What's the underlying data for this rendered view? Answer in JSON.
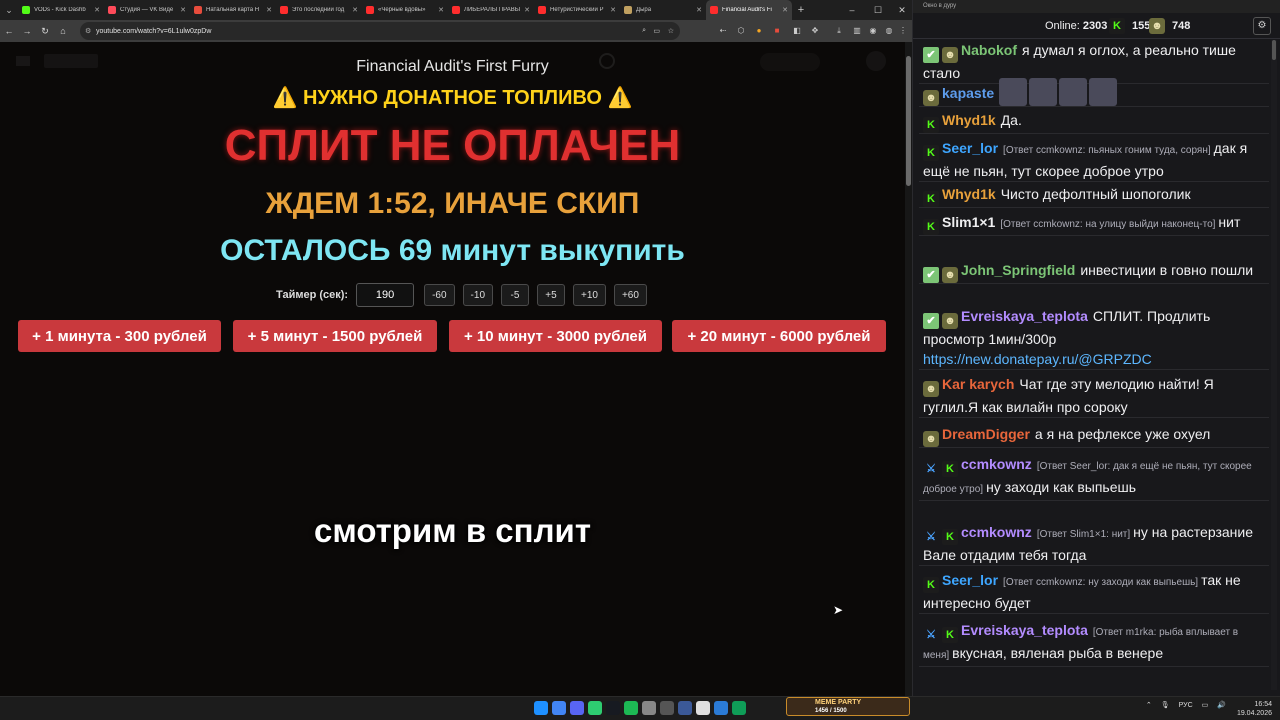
{
  "browser": {
    "tabs": [
      {
        "title": "VODs - Kick Dashb",
        "color": "#53fc18"
      },
      {
        "title": "Студия — VK Виде",
        "color": "#ff4b5a"
      },
      {
        "title": "Натальная карта Н",
        "color": "#e74c3c"
      },
      {
        "title": "Это последний год",
        "color": "#ff2d2d"
      },
      {
        "title": "«Черные вдовы»",
        "color": "#ff2d2d"
      },
      {
        "title": "ЛИБЕРАЛЫ ПРАВЫ",
        "color": "#ff2d2d"
      },
      {
        "title": "Нетуристический Р",
        "color": "#ff2d2d"
      },
      {
        "title": "Дыра",
        "color": "#c0a060"
      },
      {
        "title": "Financial Audit's Fi",
        "color": "#ff2d2d"
      }
    ],
    "url": "youtube.com/watch?v=6L1ulw0zpDw",
    "new_tab": "+",
    "minimize": "–",
    "maximize": "☐",
    "close": "✕"
  },
  "overlay": {
    "video_title": "Financial Audit's First Furry",
    "warning": "⚠️ НУЖНО ДОНАТНОЕ ТОПЛИВО ⚠️",
    "split_status": "СПЛИТ НЕ ОПЛАЧЕН",
    "wait": "ЖДЕМ 1:52, ИНАЧЕ СКИП",
    "remaining": "ОСТАЛОСЬ 69 минут выкупить",
    "timer_label": "Таймер (сек):",
    "timer_value": "190",
    "timer_buttons": [
      "-60",
      "-10",
      "-5",
      "+5",
      "+10",
      "+60"
    ],
    "buy_buttons": [
      "+ 1 минута - 300 рублей",
      "+ 5 минут - 1500 рублей",
      "+ 10 минут - 3000 рублей",
      "+ 20 минут - 6000 рублей"
    ],
    "subtitle": "смотрим в сплит"
  },
  "chat": {
    "window_title": "Окно в дуру",
    "online_label": "Online:",
    "online_count": "2303",
    "stat1": "1555",
    "stat2": "748",
    "messages": [
      {
        "user": "Nabokof",
        "color": "#7cc576",
        "badges": [
          "sub",
          "av"
        ],
        "text": "я думал я оглох, а реально тише стало"
      },
      {
        "user": "kapaste",
        "color": "#5d9cec",
        "badges": [
          "av"
        ],
        "text": "",
        "emotes": 4
      },
      {
        "user": "Whyd1k",
        "color": "#e8a13b",
        "badges": [
          "kick"
        ],
        "text": "Да."
      },
      {
        "user": "Seer_lor",
        "color": "#3ea6ff",
        "badges": [
          "kick"
        ],
        "reply": "[Ответ ccmkownz: пьяных гоним туда, сорян]",
        "text": "дак я ещё не пьян, тут скорее доброе утро"
      },
      {
        "user": "Whyd1k",
        "color": "#e8a13b",
        "badges": [
          "kick"
        ],
        "text": "Чисто дефолтный шопоголик"
      },
      {
        "user": "Slim1×1",
        "color": "#efeff1",
        "badges": [
          "kick"
        ],
        "reply": "[Ответ ccmkownz: на улицу выйди наконец-то]",
        "text": "нит"
      },
      {
        "user": "John_Springfield",
        "color": "#7cc576",
        "badges": [
          "sub",
          "av"
        ],
        "text": "инвестиции в говно пошли"
      },
      {
        "user": "Evreiskaya_teplota",
        "color": "#b38cff",
        "badges": [
          "sub",
          "av"
        ],
        "text": "СПЛИТ. Продлить просмотр 1мин/300р",
        "link": "https://new.donatepay.ru/@GRPZDC"
      },
      {
        "user": "Kar karych",
        "color": "#e8663b",
        "badges": [
          "av"
        ],
        "text": "Чат где эту мелодию найти! Я гуглил.Я как вилайн про сороку"
      },
      {
        "user": "DreamDigger",
        "color": "#e8663b",
        "badges": [
          "av"
        ],
        "text": "а я на рефлексе уже охуел"
      },
      {
        "user": "ccmkownz",
        "color": "#b38cff",
        "badges": [
          "mod",
          "kick"
        ],
        "reply": "[Ответ Seer_lor: дак я ещё не пьян, тут скорее доброе утро]",
        "text": "ну заходи как выпьешь"
      },
      {
        "user": "ccmkownz",
        "color": "#b38cff",
        "badges": [
          "mod",
          "kick"
        ],
        "reply": "[Ответ Slim1×1: нит]",
        "text": "ну на растерзание Вале отдадим тебя тогда"
      },
      {
        "user": "Seer_lor",
        "color": "#3ea6ff",
        "badges": [
          "kick"
        ],
        "reply": "[Ответ ccmkownz: ну заходи как выпьешь]",
        "text": "так не интересно будет"
      },
      {
        "user": "Evreiskaya_teplota",
        "color": "#b38cff",
        "badges": [
          "mod",
          "kick"
        ],
        "reply": "[Ответ m1rka: рыба вплывает в меня]",
        "text": "вкусная, вяленая рыба в венере"
      }
    ]
  },
  "taskbar": {
    "meme_banner": "MEME PARTY",
    "meme_sub": "1456 / 1500",
    "lang": "РУС",
    "time": "16:54",
    "date": "19.04.2026"
  },
  "colors": {
    "kick_green": "#53fc18",
    "buy_red": "#c9393d"
  }
}
